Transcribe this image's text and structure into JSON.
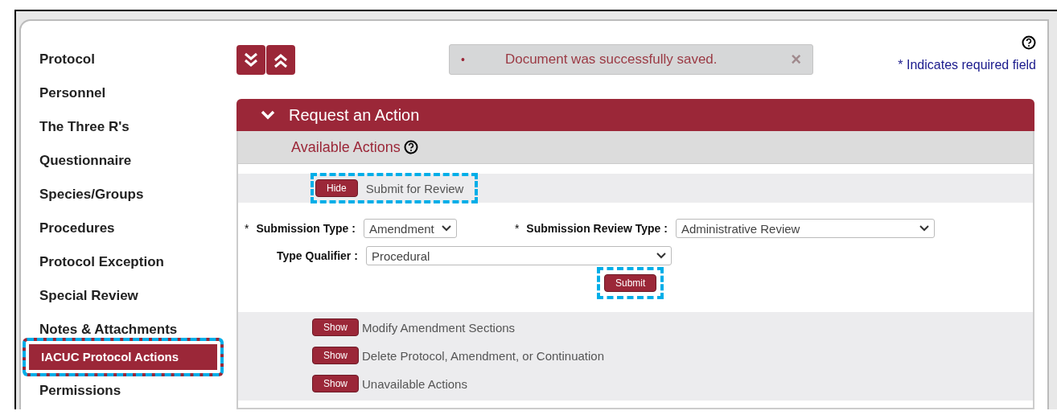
{
  "sidebar": {
    "items": [
      {
        "label": "Protocol",
        "selected": false,
        "highlighted": false
      },
      {
        "label": "Personnel",
        "selected": false,
        "highlighted": false
      },
      {
        "label": "The Three R's",
        "selected": false,
        "highlighted": false
      },
      {
        "label": "Questionnaire",
        "selected": false,
        "highlighted": false
      },
      {
        "label": "Species/Groups",
        "selected": false,
        "highlighted": false
      },
      {
        "label": "Procedures",
        "selected": false,
        "highlighted": false
      },
      {
        "label": "Protocol Exception",
        "selected": false,
        "highlighted": false
      },
      {
        "label": "Special Review",
        "selected": false,
        "highlighted": false
      },
      {
        "label": "Notes & Attachments",
        "selected": false,
        "highlighted": false
      },
      {
        "label": "IACUC Protocol Actions",
        "selected": true,
        "highlighted": true
      },
      {
        "label": "Permissions",
        "selected": false,
        "highlighted": false
      }
    ]
  },
  "message": {
    "bullet": "•",
    "text": "Document was successfully saved.",
    "close": "×"
  },
  "required_note": "* Indicates required field",
  "panel": {
    "title": "Request an Action",
    "expanded": true,
    "subtitle": "Available Actions",
    "open_action": {
      "button": "Hide",
      "label": "Submit for Review",
      "highlighted": true
    },
    "fields": [
      {
        "required_mark": "*",
        "label": "Submission Type :",
        "value": "Amendment"
      },
      {
        "required_mark": "*",
        "label": "Submission Review Type :",
        "value": "Administrative Review"
      },
      {
        "label": "Type Qualifier :",
        "value": "Procedural"
      }
    ],
    "submit": {
      "label": "Submit",
      "highlighted": true
    },
    "actions": [
      {
        "button": "Show",
        "label": "Modify Amendment Sections"
      },
      {
        "button": "Show",
        "label": "Delete Protocol, Amendment, or Continuation"
      },
      {
        "button": "Show",
        "label": "Unavailable Actions"
      }
    ]
  }
}
